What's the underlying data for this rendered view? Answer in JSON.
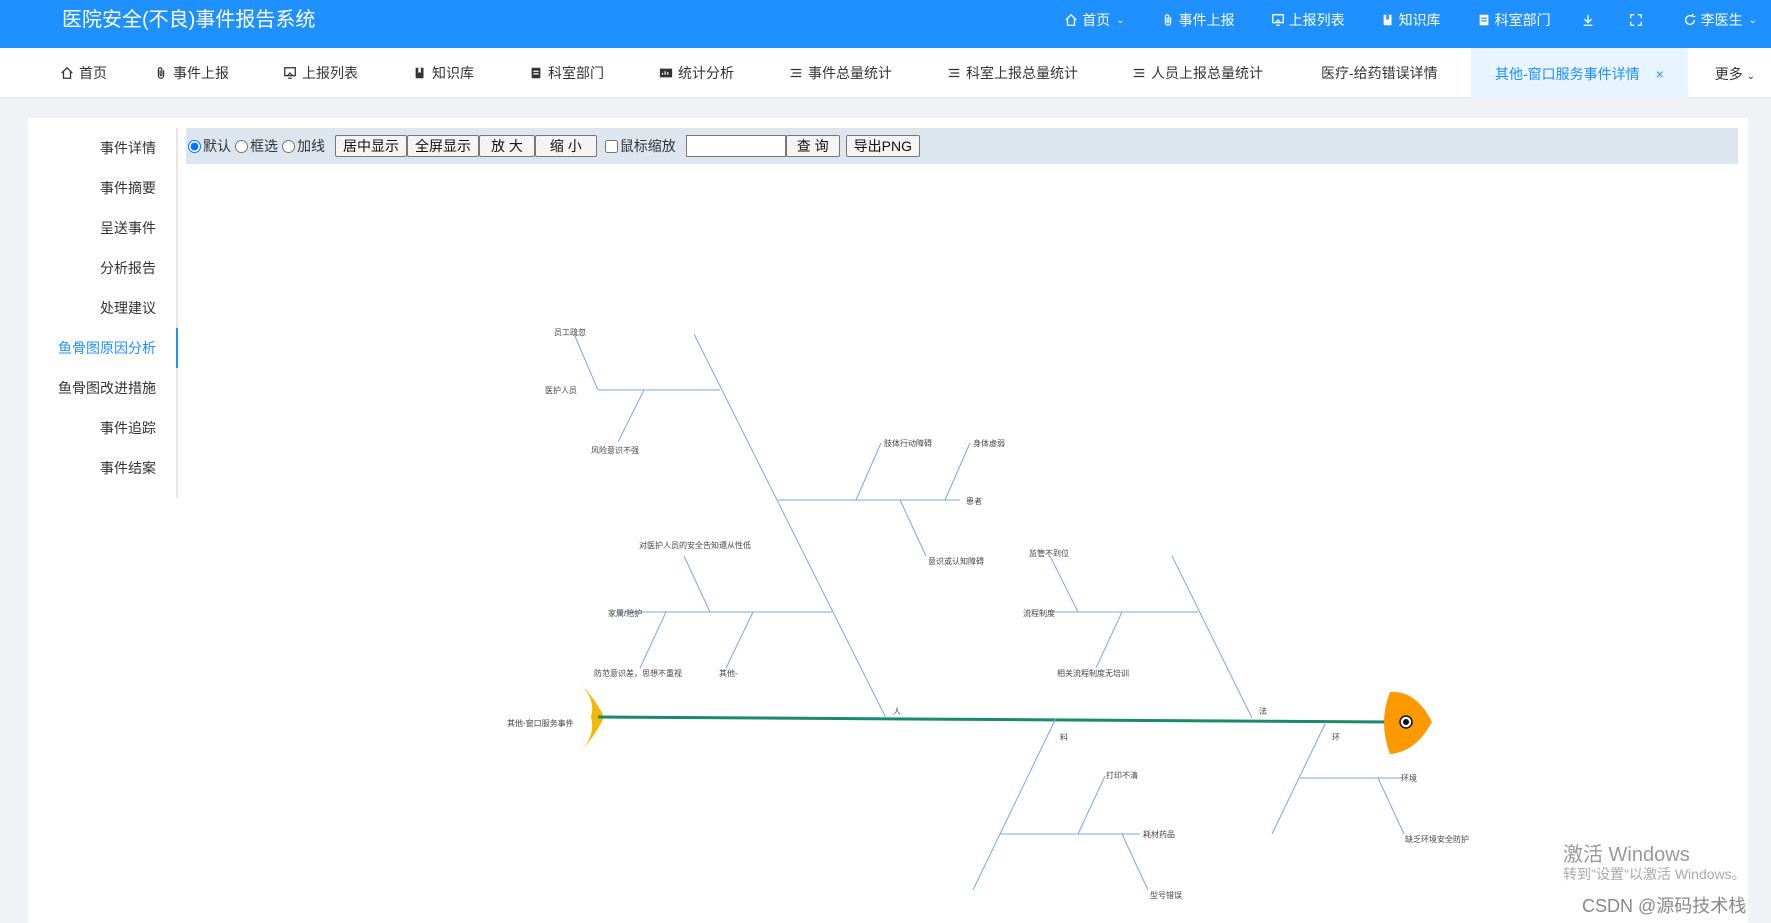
{
  "app": {
    "title": "医院安全(不良)事件报告系统"
  },
  "top_nav": [
    {
      "icon": "home-icon",
      "label": "首页",
      "dropdown": true
    },
    {
      "icon": "paperclip-icon",
      "label": "事件上报"
    },
    {
      "icon": "monitor-icon",
      "label": "上报列表"
    },
    {
      "icon": "book-icon",
      "label": "知识库"
    },
    {
      "icon": "document-icon",
      "label": "科室部门"
    }
  ],
  "user": {
    "name": "李医生",
    "icon": "refresh-icon"
  },
  "tabs": [
    {
      "icon": "home-icon",
      "label": "首页"
    },
    {
      "icon": "paperclip-icon",
      "label": "事件上报"
    },
    {
      "icon": "monitor-icon",
      "label": "上报列表"
    },
    {
      "icon": "book-icon",
      "label": "知识库"
    },
    {
      "icon": "document-icon",
      "label": "科室部门"
    },
    {
      "icon": "stats-icon",
      "label": "统计分析"
    },
    {
      "icon": "list-icon",
      "label": "事件总量统计"
    },
    {
      "icon": "list-icon",
      "label": "科室上报总量统计"
    },
    {
      "icon": "list-icon",
      "label": "人员上报总量统计"
    },
    {
      "icon": "",
      "label": "医疗-给药错误详情"
    },
    {
      "icon": "",
      "label": "其他-窗口服务事件详情",
      "active": true,
      "closable": true
    }
  ],
  "tab_more": "更多",
  "sidenav": [
    {
      "label": "事件详情"
    },
    {
      "label": "事件摘要"
    },
    {
      "label": "呈送事件"
    },
    {
      "label": "分析报告"
    },
    {
      "label": "处理建议"
    },
    {
      "label": "鱼骨图原因分析",
      "active": true
    },
    {
      "label": "鱼骨图改进措施"
    },
    {
      "label": "事件追踪"
    },
    {
      "label": "事件结案"
    }
  ],
  "toolbar": {
    "mode_default": "默认",
    "mode_select": "框选",
    "mode_line": "加线",
    "btn_center": "居中显示",
    "btn_fullscreen": "全屏显示",
    "btn_zoom_in": "放 大",
    "btn_zoom_out": "缩 小",
    "wheel_zoom": "鼠标缩放",
    "search_value": "",
    "btn_query": "查 询",
    "btn_export": "导出PNG"
  },
  "fishbone": {
    "problem": "其他-窗口服务事件",
    "colors": {
      "spine": "#1a8a6e",
      "bone": "#7aa6e8",
      "head": "#ff9900",
      "tail": "#f5b800"
    },
    "categories": [
      {
        "name": "人",
        "causes": [
          {
            "name": "医护人员",
            "details": [
              "员工疏忽",
              "风险意识不强"
            ]
          },
          {
            "name": "患者",
            "details": [
              "肢体行动障碍",
              "身体虚弱",
              "意识或认知障碍"
            ]
          },
          {
            "name": "家属/陪护",
            "details": [
              "对医护人员的安全告知遵从性低",
              "防范意识差，思想不重视"
            ]
          },
          {
            "name": "其他-",
            "details": []
          }
        ]
      },
      {
        "name": "法",
        "causes": [
          {
            "name": "流程制度",
            "details": [
              "监管不到位",
              "相关流程制度无培训"
            ]
          }
        ]
      },
      {
        "name": "料",
        "causes": [
          {
            "name": "耗材药品",
            "details": [
              "打印不清",
              "型号错误"
            ]
          }
        ]
      },
      {
        "name": "环",
        "causes": [
          {
            "name": "环境",
            "details": [
              "缺乏环境安全防护"
            ]
          }
        ]
      }
    ]
  },
  "watermark": {
    "activate_title": "激活 Windows",
    "activate_hint": "转到\"设置\"以激活 Windows。",
    "csdn": "CSDN @源码技术栈"
  }
}
